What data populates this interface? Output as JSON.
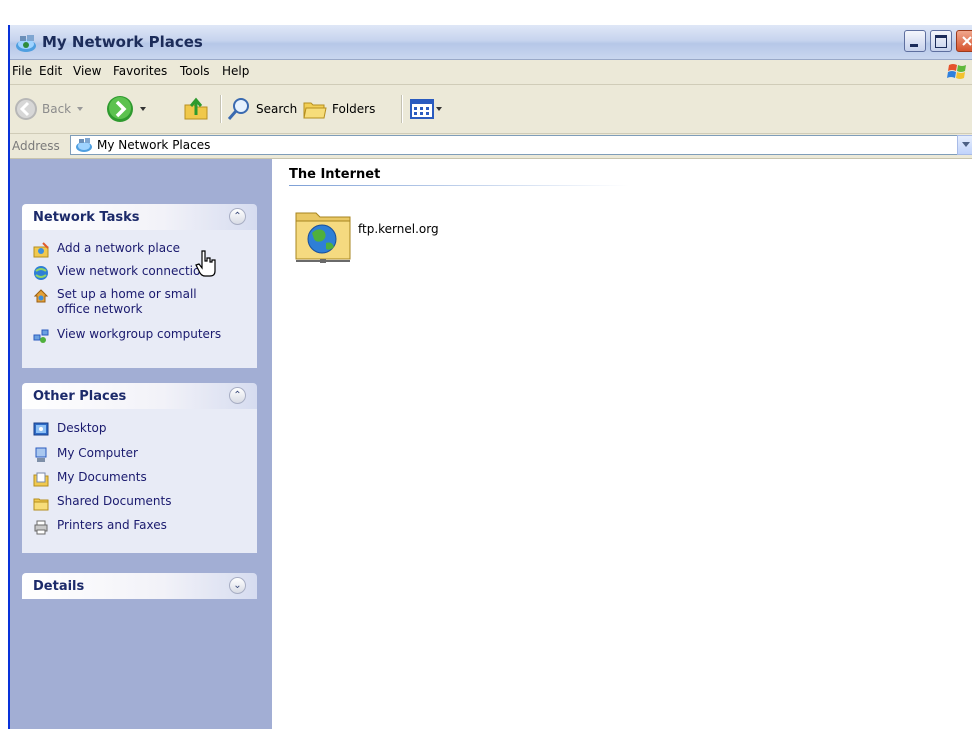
{
  "window": {
    "title": "My Network Places",
    "accent_color": "#0831d9"
  },
  "menu": [
    "File",
    "Edit",
    "View",
    "Favorites",
    "Tools",
    "Help"
  ],
  "toolbar": {
    "back_label": "Back",
    "search_label": "Search",
    "folders_label": "Folders"
  },
  "address": {
    "label": "Address",
    "value": "My Network Places"
  },
  "panels": {
    "network_tasks": {
      "title": "Network Tasks",
      "items": [
        {
          "label": "Add a network place",
          "icon": "add-network-place-icon"
        },
        {
          "label": "View network connections",
          "icon": "network-connections-icon"
        },
        {
          "label": "Set up a home or small office network",
          "icon": "home-network-setup-icon"
        },
        {
          "label": "View workgroup computers",
          "icon": "workgroup-computers-icon"
        }
      ]
    },
    "other_places": {
      "title": "Other Places",
      "items": [
        {
          "label": "Desktop",
          "icon": "desktop-icon"
        },
        {
          "label": "My Computer",
          "icon": "my-computer-icon"
        },
        {
          "label": "My Documents",
          "icon": "my-documents-icon"
        },
        {
          "label": "Shared Documents",
          "icon": "shared-documents-icon"
        },
        {
          "label": "Printers and Faxes",
          "icon": "printers-faxes-icon"
        }
      ]
    },
    "details": {
      "title": "Details"
    }
  },
  "content": {
    "group_title": "The Internet",
    "items": [
      {
        "name": "ftp.kernel.org",
        "icon": "ftp-folder-icon"
      }
    ]
  }
}
